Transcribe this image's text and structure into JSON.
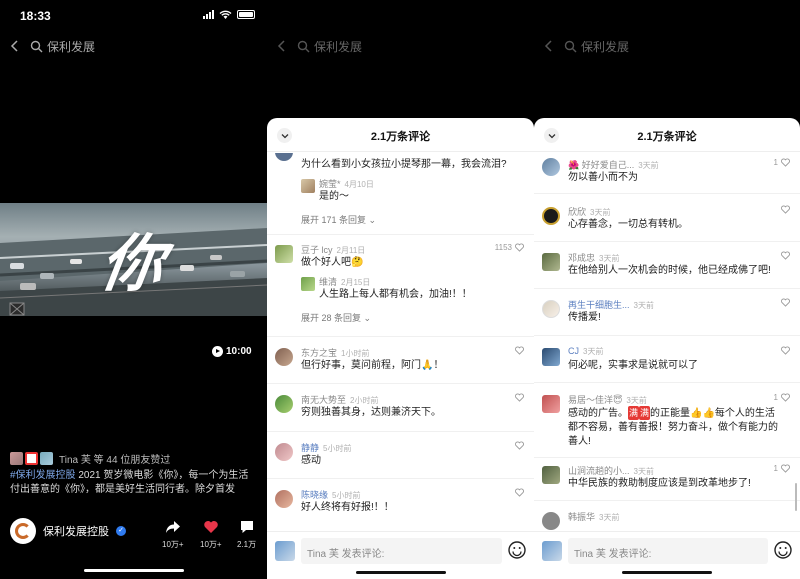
{
  "status": {
    "time": "18:33"
  },
  "nav": {
    "search_keyword": "保利发展"
  },
  "video": {
    "title_char": "你",
    "duration": "10:00"
  },
  "post": {
    "likers_text": "Tina 芙 等 44 位朋友赞过",
    "description_tag": "#保利发展控股",
    "description_text": " 2021 贺岁微电影《你》，每一个为生活付出善意的《你》，都是美好生活同行者。除夕首发",
    "author": "保利发展控股",
    "share_count": "10万+",
    "like_count": "10万+",
    "comment_count": "2.1万"
  },
  "comments_title": "2.1万条评论",
  "input_placeholder": "Tina 芙 发表评论:",
  "panel2": {
    "c0": {
      "text": "为什么看到小女孩拉小提琴那一幕，我会流泪?"
    },
    "c0_reply": {
      "user": "婉莹*",
      "time": "4月10日",
      "text": "是的～"
    },
    "c0_more": "展开 171 条回复",
    "c1": {
      "user": "豆子 lcy",
      "time": "2月11日",
      "text": "做个好人吧🤔",
      "likes": "1153"
    },
    "c1_reply": {
      "user": "维清",
      "time": "2月15日",
      "text": "人生路上每人都有机会，加油!！！"
    },
    "c1_more": "展开 28 条回复",
    "c2": {
      "user": "东方之宝",
      "time": "1小时前",
      "text": "但行好事，莫问前程，阿门🙏！"
    },
    "c3": {
      "user": "南无大势至",
      "time": "2小时前",
      "text": "穷则独善其身，达则兼济天下。"
    },
    "c4": {
      "user": "静静",
      "time": "5小时前",
      "text": "感动"
    },
    "c5": {
      "user": "陈晓缘",
      "time": "5小时前",
      "text": "好人终将有好报!！！"
    }
  },
  "panel3": {
    "c0": {
      "user": "好好爱自己...",
      "time": "3天前",
      "text": "勿以善小而不为",
      "likes": "1"
    },
    "c1": {
      "user": "欣欣",
      "time": "3天前",
      "text": "心存善念，一切总有转机。"
    },
    "c2": {
      "user": "邓成忠",
      "time": "3天前",
      "text": "在他给别人一次机会的时候，他已经成佛了吧!"
    },
    "c3": {
      "user": "再生干细胞生...",
      "time": "3天前",
      "text": "传播爱!"
    },
    "c4": {
      "user": "CJ",
      "time": "3天前",
      "text": "何必呢，实事求是说就可以了"
    },
    "c5": {
      "user": "易居～佳洋😇",
      "time": "3天前",
      "text_a": "感动的广告。",
      "emo1": "满",
      "emo2": "满",
      "text_b": "的正能量👍👍每个人的生活都不容易，善有善报！努力奋斗，做个有能力的善人!",
      "likes": "1"
    },
    "c6": {
      "user": "山涧流趟的小...",
      "time": "3天前",
      "text": "中华民族的救助制度应该是到改革地步了!",
      "likes": "1"
    },
    "c7": {
      "user": "韩振华",
      "time": "3天前"
    }
  },
  "colors": {
    "like_red": "#e8364a",
    "link_blue": "#5b7fc0"
  }
}
